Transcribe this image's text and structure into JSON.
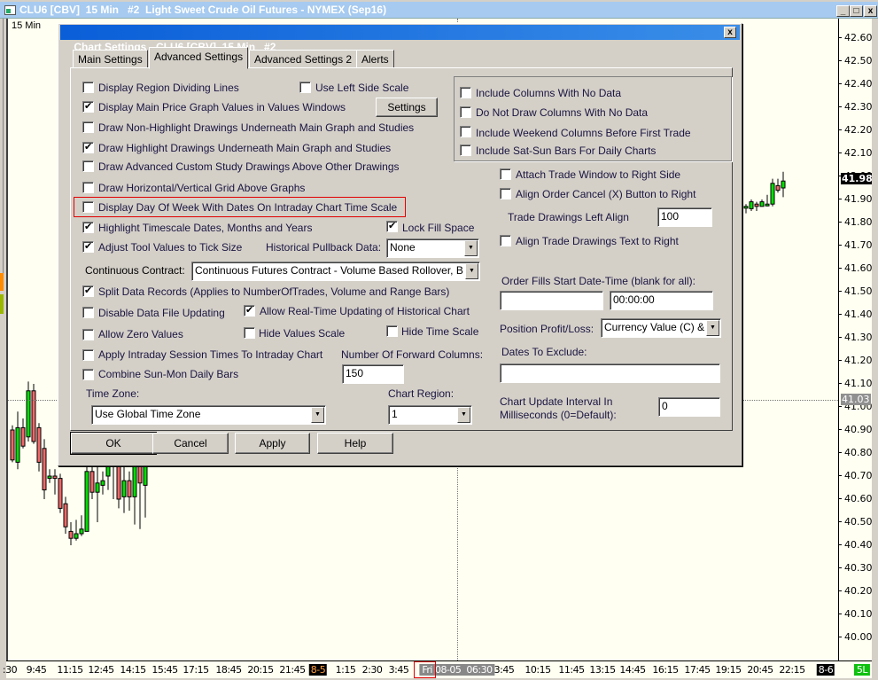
{
  "window": {
    "title": "CLU6 [CBV]  15 Min   #2  Light Sweet Crude Oil Futures - NYMEX (Sep16)",
    "minimize": "_",
    "maximize": "□",
    "close": "x"
  },
  "chart": {
    "interval_label": "15 Min",
    "price_ticks": [
      "42.60",
      "42.50",
      "42.40",
      "42.30",
      "42.20",
      "42.10",
      "42.00",
      "41.90",
      "41.80",
      "41.70",
      "41.60",
      "41.50",
      "41.40",
      "41.30",
      "41.20",
      "41.10",
      "41.00",
      "40.90",
      "40.80",
      "40.70",
      "40.60",
      "40.50",
      "40.40",
      "40.30",
      "40.20",
      "40.10",
      "40.00"
    ],
    "last_price": "41.98",
    "crosshair_price": "41.03",
    "time_labels": [
      ":30",
      "9:45",
      "11:15",
      "12:45",
      "14:15",
      "15:45",
      "17:15",
      "18:45",
      "20:15",
      "21:45",
      "8-5",
      "1:15",
      "2:30",
      "3:45",
      "3:45",
      "10:15",
      "11:45",
      "13:15",
      "14:45",
      "16:15",
      "17:45",
      "19:15",
      "20:45",
      "22:15",
      "8-6"
    ],
    "crosshair_time": "Fri 08-05  06:30",
    "status_badge": "5L",
    "colors": {
      "up": "#00e000",
      "down": "#f06868",
      "background": "#fffff2"
    }
  },
  "chart_data": {
    "type": "candlestick",
    "ylim": [
      40.0,
      42.6
    ],
    "candles": [
      {
        "i": 0,
        "o": 40.9,
        "h": 40.92,
        "l": 40.76,
        "c": 40.77
      },
      {
        "i": 1,
        "o": 40.76,
        "h": 40.98,
        "l": 40.73,
        "c": 40.91
      },
      {
        "i": 2,
        "o": 40.91,
        "h": 40.95,
        "l": 40.82,
        "c": 40.83
      },
      {
        "i": 3,
        "o": 40.87,
        "h": 41.11,
        "l": 40.85,
        "c": 41.07
      },
      {
        "i": 4,
        "o": 41.07,
        "h": 41.1,
        "l": 40.84,
        "c": 40.85
      },
      {
        "i": 5,
        "o": 40.91,
        "h": 40.93,
        "l": 40.72,
        "c": 40.76
      },
      {
        "i": 6,
        "o": 40.82,
        "h": 40.86,
        "l": 40.6,
        "c": 40.64
      },
      {
        "i": 7,
        "o": 40.69,
        "h": 40.73,
        "l": 40.67,
        "c": 40.7
      },
      {
        "i": 8,
        "o": 40.7,
        "h": 40.73,
        "l": 40.62,
        "c": 40.69
      },
      {
        "i": 9,
        "o": 40.69,
        "h": 40.71,
        "l": 40.54,
        "c": 40.56
      },
      {
        "i": 10,
        "o": 40.58,
        "h": 40.61,
        "l": 40.45,
        "c": 40.48
      },
      {
        "i": 11,
        "o": 40.46,
        "h": 40.5,
        "l": 40.4,
        "c": 40.43
      },
      {
        "i": 12,
        "o": 40.43,
        "h": 40.51,
        "l": 40.42,
        "c": 40.45
      },
      {
        "i": 13,
        "o": 40.45,
        "h": 40.53,
        "l": 40.44,
        "c": 40.47
      },
      {
        "i": 14,
        "o": 40.46,
        "h": 40.75,
        "l": 40.46,
        "c": 40.72
      },
      {
        "i": 15,
        "o": 40.72,
        "h": 40.76,
        "l": 40.6,
        "c": 40.63
      },
      {
        "i": 16,
        "o": 40.63,
        "h": 40.75,
        "l": 40.5,
        "c": 40.67
      },
      {
        "i": 17,
        "o": 40.66,
        "h": 40.72,
        "l": 40.62,
        "c": 40.68
      },
      {
        "i": 18,
        "o": 40.7,
        "h": 40.78,
        "l": 40.64,
        "c": 40.8
      },
      {
        "i": 19,
        "o": 40.78,
        "h": 40.8,
        "l": 40.6,
        "c": 40.75
      },
      {
        "i": 20,
        "o": 40.75,
        "h": 40.78,
        "l": 40.56,
        "c": 40.6
      },
      {
        "i": 21,
        "o": 40.61,
        "h": 40.74,
        "l": 40.54,
        "c": 40.68
      },
      {
        "i": 22,
        "o": 40.68,
        "h": 40.72,
        "l": 40.55,
        "c": 40.61
      },
      {
        "i": 23,
        "o": 40.61,
        "h": 40.79,
        "l": 40.49,
        "c": 40.77
      },
      {
        "i": 24,
        "o": 40.8,
        "h": 40.82,
        "l": 40.47,
        "c": 40.67
      },
      {
        "i": 25,
        "o": 40.66,
        "h": 40.8,
        "l": 40.52,
        "c": 40.8
      },
      {
        "i": 138,
        "o": 41.87,
        "h": 41.88,
        "l": 41.84,
        "c": 41.87
      },
      {
        "i": 139,
        "o": 41.86,
        "h": 41.9,
        "l": 41.85,
        "c": 41.89
      },
      {
        "i": 140,
        "o": 41.88,
        "h": 41.89,
        "l": 41.85,
        "c": 41.87
      },
      {
        "i": 141,
        "o": 41.87,
        "h": 41.9,
        "l": 41.87,
        "c": 41.89
      },
      {
        "i": 142,
        "o": 41.88,
        "h": 41.92,
        "l": 41.87,
        "c": 41.88
      },
      {
        "i": 143,
        "o": 41.88,
        "h": 41.99,
        "l": 41.87,
        "c": 41.97
      },
      {
        "i": 144,
        "o": 41.96,
        "h": 41.99,
        "l": 41.93,
        "c": 41.94
      },
      {
        "i": 145,
        "o": 41.95,
        "h": 42.02,
        "l": 41.91,
        "c": 41.98
      }
    ]
  },
  "dialog": {
    "title": "Chart Settings - CLU6 [CBV]  15 Min   #2",
    "close": "x",
    "tabs": [
      "Main Settings",
      "Advanced Settings",
      "Advanced Settings 2",
      "Alerts"
    ],
    "active_tab": "Advanced Settings",
    "left": {
      "display_region_dividing_lines": {
        "label": "Display Region Dividing Lines",
        "checked": false
      },
      "use_left_side_scale": {
        "label": "Use Left Side Scale",
        "checked": false
      },
      "display_main_price_values": {
        "label": "Display Main Price Graph Values in Values Windows",
        "checked": true
      },
      "settings_button": "Settings",
      "draw_non_highlight": {
        "label": "Draw Non-Highlight Drawings Underneath Main Graph and Studies",
        "checked": false
      },
      "draw_highlight": {
        "label": "Draw Highlight Drawings Underneath Main Graph and Studies",
        "checked": true
      },
      "draw_advanced_custom": {
        "label": "Draw Advanced Custom Study Drawings Above Other Drawings",
        "checked": false
      },
      "draw_grid_above": {
        "label": "Draw Horizontal/Vertical Grid Above Graphs",
        "checked": false
      },
      "display_day_of_week": {
        "label": "Display Day Of Week With Dates On Intraday Chart Time Scale",
        "checked": false
      },
      "highlight_timescale": {
        "label": "Highlight Timescale Dates, Months and Years",
        "checked": true
      },
      "lock_fill_space": {
        "label": "Lock Fill Space",
        "checked": true
      },
      "adjust_tool_values": {
        "label": "Adjust Tool Values to Tick Size",
        "checked": true
      },
      "historical_pullback_label": "Historical Pullback Data:",
      "historical_pullback_value": "None",
      "continuous_contract_label": "Continuous Contract:",
      "continuous_contract_value": "Continuous Futures Contract - Volume Based Rollover, B",
      "split_data_records": {
        "label": "Split Data Records (Applies to NumberOfTrades, Volume and Range Bars)",
        "checked": true
      },
      "disable_data_file_updating": {
        "label": "Disable Data File Updating",
        "checked": false
      },
      "allow_realtime_updating": {
        "label": "Allow Real-Time Updating of Historical Chart",
        "checked": true
      },
      "allow_zero_values": {
        "label": "Allow Zero Values",
        "checked": false
      },
      "hide_values_scale": {
        "label": "Hide Values Scale",
        "checked": false
      },
      "hide_time_scale": {
        "label": "Hide Time Scale",
        "checked": false
      },
      "apply_intraday_session": {
        "label": "Apply Intraday Session Times To Intraday Chart",
        "checked": false
      },
      "forward_columns_label": "Number Of Forward Columns:",
      "forward_columns_value": "150",
      "combine_sun_mon": {
        "label": "Combine Sun-Mon Daily Bars",
        "checked": false
      },
      "time_zone_label": "Time Zone:",
      "time_zone_value": "Use Global Time Zone",
      "chart_region_label": "Chart Region:",
      "chart_region_value": "1"
    },
    "right": {
      "include_columns_no_data": {
        "label": "Include Columns With No Data",
        "checked": false
      },
      "do_not_draw_columns": {
        "label": "Do Not Draw Columns With No Data",
        "checked": false
      },
      "include_weekend_columns": {
        "label": "Include Weekend Columns Before First Trade",
        "checked": false
      },
      "include_sat_sun": {
        "label": "Include Sat-Sun Bars For Daily Charts",
        "checked": false
      },
      "attach_trade_window": {
        "label": "Attach Trade Window to Right Side",
        "checked": false
      },
      "align_order_cancel": {
        "label": "Align Order Cancel (X) Button to Right",
        "checked": false
      },
      "trade_drawings_left_align_label": "Trade Drawings Left Align",
      "trade_drawings_left_align_value": "100",
      "align_trade_text": {
        "label": "Align Trade Drawings Text to Right",
        "checked": false
      },
      "order_fills_label": "Order Fills Start Date-Time (blank for all):",
      "order_fills_date": "",
      "order_fills_time": "00:00:00",
      "position_pl_label": "Position Profit/Loss:",
      "position_pl_value": "Currency Value (C) &",
      "dates_to_exclude_label": "Dates To Exclude:",
      "dates_to_exclude_value": "",
      "update_interval_label_1": "Chart Update Interval In",
      "update_interval_label_2": "Milliseconds (0=Default):",
      "update_interval_value": "0"
    },
    "buttons": {
      "ok": "OK",
      "cancel": "Cancel",
      "apply": "Apply",
      "help": "Help"
    }
  }
}
